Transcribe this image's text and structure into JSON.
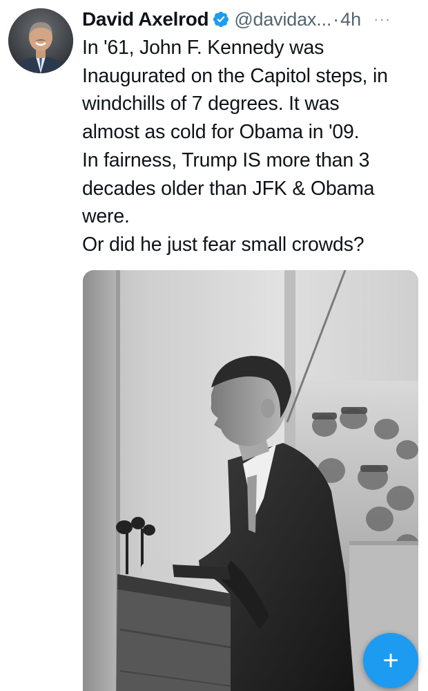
{
  "tweet": {
    "author_name": "David Axelrod",
    "author_handle": "@davidax...",
    "separator": "·",
    "timestamp": "4h",
    "more_label": "···",
    "verified": true,
    "accent_color": "#1d9bf0",
    "text_lines": [
      "In '61, John F. Kennedy was",
      "Inaugurated on the Capitol steps, in",
      "windchills of 7 degrees. It was",
      "almost as cold for Obama in '09.",
      "In fairness, Trump IS more than 3",
      "decades older than JFK & Obama",
      "were.",
      "Or did he just fear small crowds?"
    ]
  },
  "compose_button": {
    "label": "+",
    "icon": "plus-icon",
    "color": "#1d9bf0"
  }
}
